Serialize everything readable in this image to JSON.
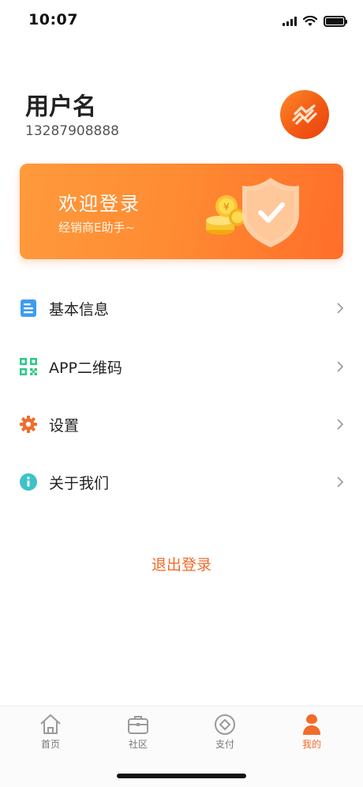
{
  "status_bar": {
    "time": "10:07"
  },
  "profile": {
    "username": "用户名",
    "phone": "13287908888"
  },
  "banner": {
    "title": "欢迎登录",
    "subtitle": "经销商E助手~"
  },
  "menu": [
    {
      "label": "基本信息",
      "icon": "document-icon",
      "color": "#3d9cf0"
    },
    {
      "label": "APP二维码",
      "icon": "qr-code-icon",
      "color": "#2ec987"
    },
    {
      "label": "设置",
      "icon": "gear-icon",
      "color": "#f26b2a"
    },
    {
      "label": "关于我们",
      "icon": "info-icon",
      "color": "#3dc2c9"
    }
  ],
  "logout_label": "退出登录",
  "tabbar": {
    "tabs": [
      {
        "label": "首页",
        "icon": "home-icon"
      },
      {
        "label": "社区",
        "icon": "briefcase-icon"
      },
      {
        "label": "支付",
        "icon": "payment-icon"
      },
      {
        "label": "我的",
        "icon": "person-icon"
      }
    ],
    "active": "我的"
  },
  "colors": {
    "accent": "#f26b2a",
    "text": "#222222",
    "muted": "#777777"
  }
}
